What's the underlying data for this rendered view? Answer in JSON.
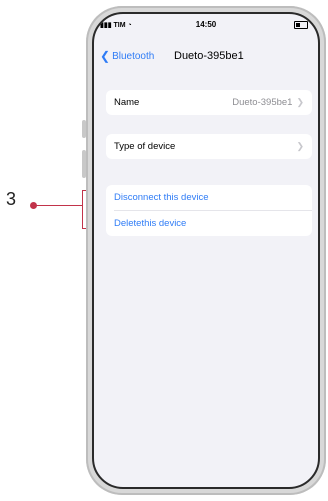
{
  "status": {
    "carrier": "TIM",
    "time": "14:50"
  },
  "nav": {
    "back_label": "Bluetooth",
    "title": "Dueto-395be1"
  },
  "device": {
    "name_label": "Name",
    "name_value": "Dueto-395be1",
    "type_label": "Type of device",
    "disconnect_label": "Disconnect this device",
    "delete_label": "Deletethis device"
  },
  "callout": {
    "number": "3"
  },
  "colors": {
    "accent": "#2f7cf6",
    "callout": "#c2334a",
    "background": "#f2f2f7"
  }
}
